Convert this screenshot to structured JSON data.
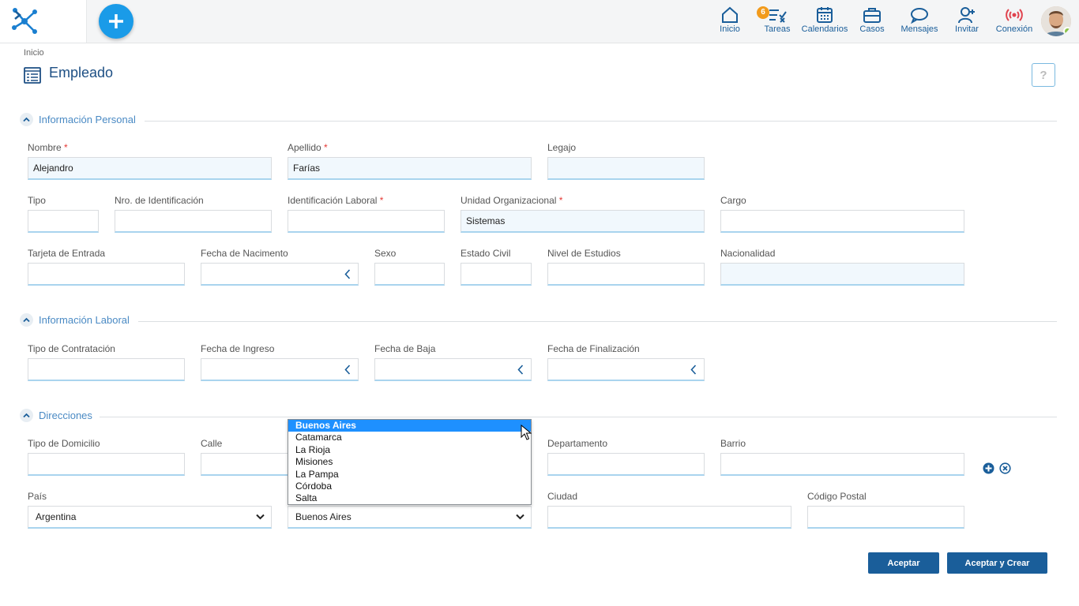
{
  "topbar": {
    "nav": [
      {
        "label": "Inicio",
        "icon": "home-icon"
      },
      {
        "label": "Tareas",
        "icon": "tasks-icon",
        "badge": "6"
      },
      {
        "label": "Calendarios",
        "icon": "calendar-icon"
      },
      {
        "label": "Casos",
        "icon": "briefcase-icon"
      },
      {
        "label": "Mensajes",
        "icon": "chat-icon"
      },
      {
        "label": "Invitar",
        "icon": "add-user-icon"
      },
      {
        "label": "Conexión",
        "icon": "connection-icon"
      }
    ],
    "accent": "#1a9be8",
    "nav_color": "#1a5e9a"
  },
  "breadcrumb": "Inicio",
  "page": {
    "title": "Empleado",
    "help": "?"
  },
  "sections": {
    "personal": "Información Personal",
    "laboral": "Información Laboral",
    "direcciones": "Direcciones"
  },
  "fields": {
    "nombre": {
      "label": "Nombre",
      "value": "Alejandro",
      "required": true
    },
    "apellido": {
      "label": "Apellido",
      "value": "Farías",
      "required": true
    },
    "legajo": {
      "label": "Legajo",
      "value": ""
    },
    "tipo": {
      "label": "Tipo",
      "value": ""
    },
    "nro_identificacion": {
      "label": "Nro. de Identificación",
      "value": ""
    },
    "identificacion_laboral": {
      "label": "Identificación Laboral",
      "value": "",
      "required": true
    },
    "unidad_organizacional": {
      "label": "Unidad Organizacional",
      "value": "Sistemas",
      "required": true
    },
    "cargo": {
      "label": "Cargo",
      "value": ""
    },
    "tarjeta_entrada": {
      "label": "Tarjeta de Entrada",
      "value": ""
    },
    "fecha_nacimiento": {
      "label": "Fecha de Nacimento",
      "value": ""
    },
    "sexo": {
      "label": "Sexo",
      "value": ""
    },
    "estado_civil": {
      "label": "Estado Civil",
      "value": ""
    },
    "nivel_estudios": {
      "label": "Nivel de Estudios",
      "value": ""
    },
    "nacionalidad": {
      "label": "Nacionalidad",
      "value": ""
    },
    "tipo_contratacion": {
      "label": "Tipo de Contratación",
      "value": ""
    },
    "fecha_ingreso": {
      "label": "Fecha de Ingreso",
      "value": ""
    },
    "fecha_baja": {
      "label": "Fecha de Baja",
      "value": ""
    },
    "fecha_finalizacion": {
      "label": "Fecha de Finalización",
      "value": ""
    },
    "tipo_domicilio": {
      "label": "Tipo de Domicilio",
      "value": ""
    },
    "calle": {
      "label": "Calle",
      "value": ""
    },
    "departamento": {
      "label": "Departamento",
      "value": ""
    },
    "barrio": {
      "label": "Barrio",
      "value": ""
    },
    "pais": {
      "label": "País",
      "value": "Argentina"
    },
    "provincia": {
      "value": "Buenos Aires"
    },
    "ciudad": {
      "label": "Ciudad",
      "value": ""
    },
    "codigo_postal": {
      "label": "Código Postal",
      "value": ""
    }
  },
  "province_dropdown": {
    "options": [
      "Buenos Aires",
      "Catamarca",
      "La Rioja",
      "Misiones",
      "La Pampa",
      "Córdoba",
      "Salta"
    ],
    "selected": "Buenos Aires"
  },
  "buttons": {
    "aceptar": "Aceptar",
    "aceptar_crear": "Aceptar y Crear"
  }
}
